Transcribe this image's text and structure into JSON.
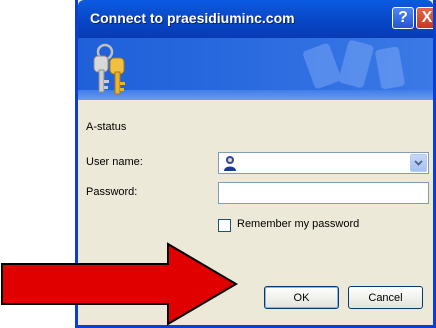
{
  "window": {
    "title": "Connect to praesidiuminc.com",
    "help_glyph": "?",
    "close_glyph": "X"
  },
  "form": {
    "status_label": "A-status",
    "user_name_label": "User name:",
    "password_label": "Password:",
    "user_name_value": "",
    "password_value": "",
    "remember_label": "Remember my password",
    "remember_checked": false
  },
  "buttons": {
    "ok_label": "OK",
    "cancel_label": "Cancel"
  },
  "colors": {
    "titlebar": "#0845c4",
    "dialog_bg": "#ece9d8",
    "arrow": "#e00000"
  },
  "icons": [
    "keys-icon",
    "user-icon",
    "dropdown-arrow-icon",
    "help-icon",
    "close-icon",
    "red-arrow"
  ]
}
